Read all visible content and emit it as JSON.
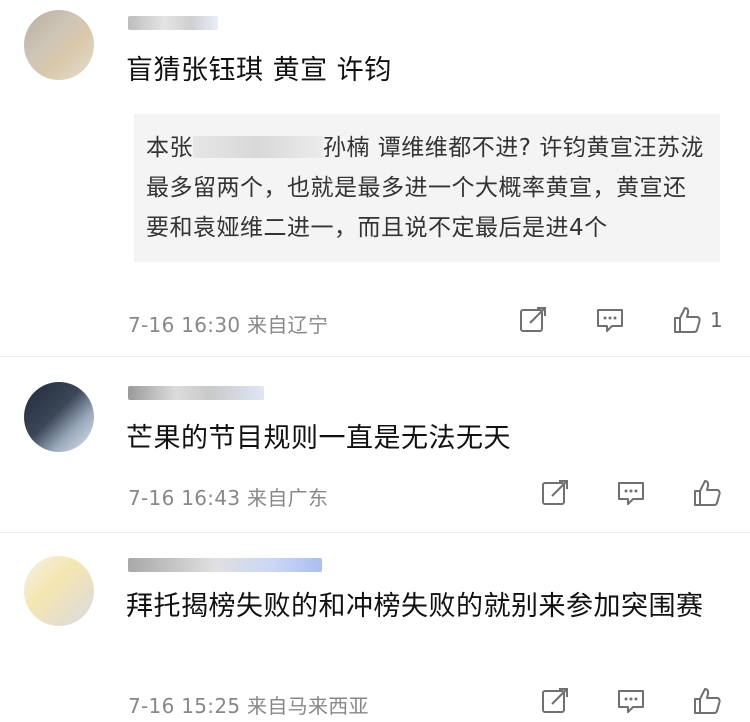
{
  "comments": [
    {
      "text": "盲猜张钰琪 黄宣 许钧",
      "quote": {
        "prefix": "本张",
        "rest": "孙楠 谭维维都不进? 许钧黄宣汪苏泷最多留两个，也就是最多进一个大概率黄宣，黄宣还要和袁娅维二进一，而且说不定最后是进4个"
      },
      "time": "7-16 16:30 来自辽宁",
      "icons": [
        "share-icon",
        "comment-icon",
        "like-icon"
      ],
      "like_count": "1"
    },
    {
      "text": "芒果的节目规则一直是无法无天",
      "time": "7-16 16:43 来自广东",
      "icons": [
        "share-icon",
        "comment-icon",
        "like-icon"
      ]
    },
    {
      "text": "拜托揭榜失败的和冲榜失败的就别来参加突围赛",
      "time": "7-16 15:25 来自马来西亚",
      "icons": [
        "share-icon",
        "comment-icon",
        "like-icon"
      ]
    }
  ]
}
